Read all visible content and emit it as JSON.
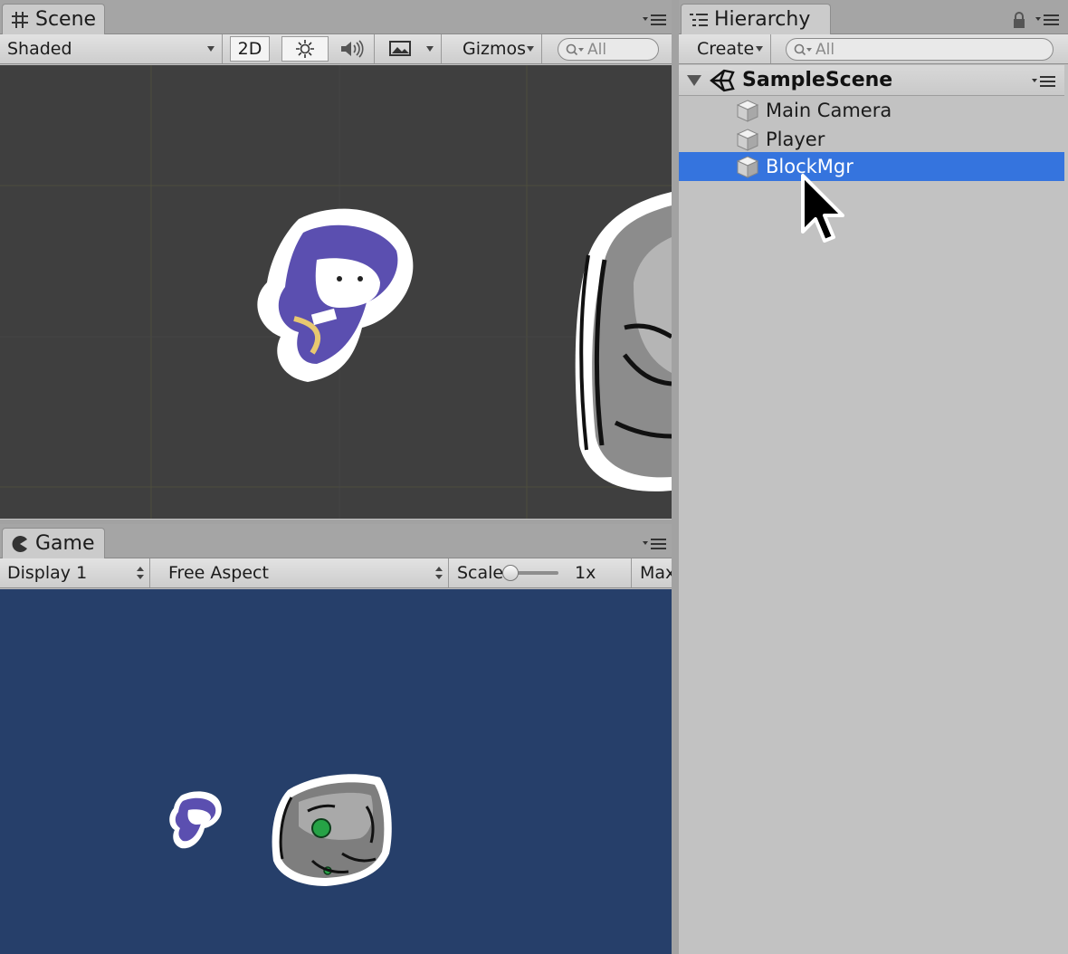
{
  "scene": {
    "tab_label": "Scene",
    "shading_mode": "Shaded",
    "mode_2d": "2D",
    "gizmos_label": "Gizmos",
    "search_placeholder": "All"
  },
  "game": {
    "tab_label": "Game",
    "display": "Display 1",
    "aspect": "Free Aspect",
    "scale_label": "Scale",
    "scale_value": "1x",
    "maximize_label": "Max"
  },
  "hierarchy": {
    "tab_label": "Hierarchy",
    "create_label": "Create",
    "search_placeholder": "All",
    "scene_name": "SampleScene",
    "items": [
      {
        "label": "Main Camera",
        "selected": false
      },
      {
        "label": "Player",
        "selected": false
      },
      {
        "label": "BlockMgr",
        "selected": true
      }
    ]
  },
  "colors": {
    "scene_bg": "#3f3f3f",
    "game_bg": "#263f6a",
    "selection": "#3574de"
  }
}
